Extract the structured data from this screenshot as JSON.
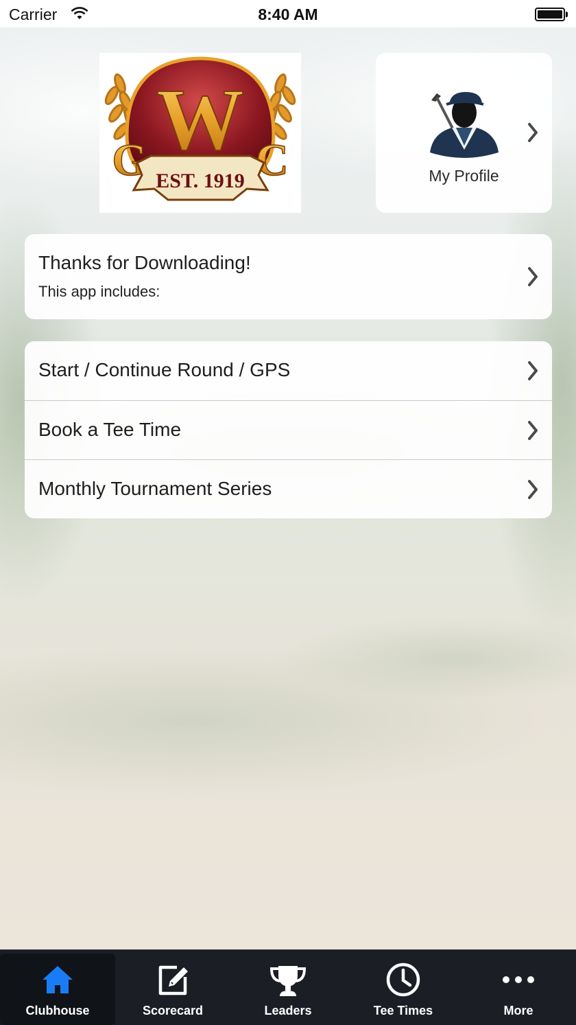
{
  "status_bar": {
    "carrier": "Carrier",
    "time": "8:40 AM"
  },
  "logo": {
    "monogram_left": "G",
    "monogram_main": "W",
    "monogram_right": "C",
    "ribbon": "EST. 1919",
    "colors": {
      "maroon": "#8a1620",
      "gold": "#e8a12a",
      "cream": "#f3e6c3"
    }
  },
  "profile": {
    "label": "My Profile",
    "icon": "golfer-avatar-icon"
  },
  "welcome_card": {
    "title": "Thanks for Downloading!",
    "subtitle": "This app includes:"
  },
  "menu": {
    "items": [
      {
        "label": "Start / Continue Round / GPS"
      },
      {
        "label": "Book a Tee Time"
      },
      {
        "label": "Monthly Tournament Series"
      }
    ]
  },
  "tab_bar": {
    "accent": "#1a7cf5",
    "tabs": [
      {
        "label": "Clubhouse",
        "icon": "home-icon",
        "active": true
      },
      {
        "label": "Scorecard",
        "icon": "edit-icon",
        "active": false
      },
      {
        "label": "Leaders",
        "icon": "trophy-icon",
        "active": false
      },
      {
        "label": "Tee Times",
        "icon": "clock-icon",
        "active": false
      },
      {
        "label": "More",
        "icon": "more-dots-icon",
        "active": false
      }
    ]
  }
}
